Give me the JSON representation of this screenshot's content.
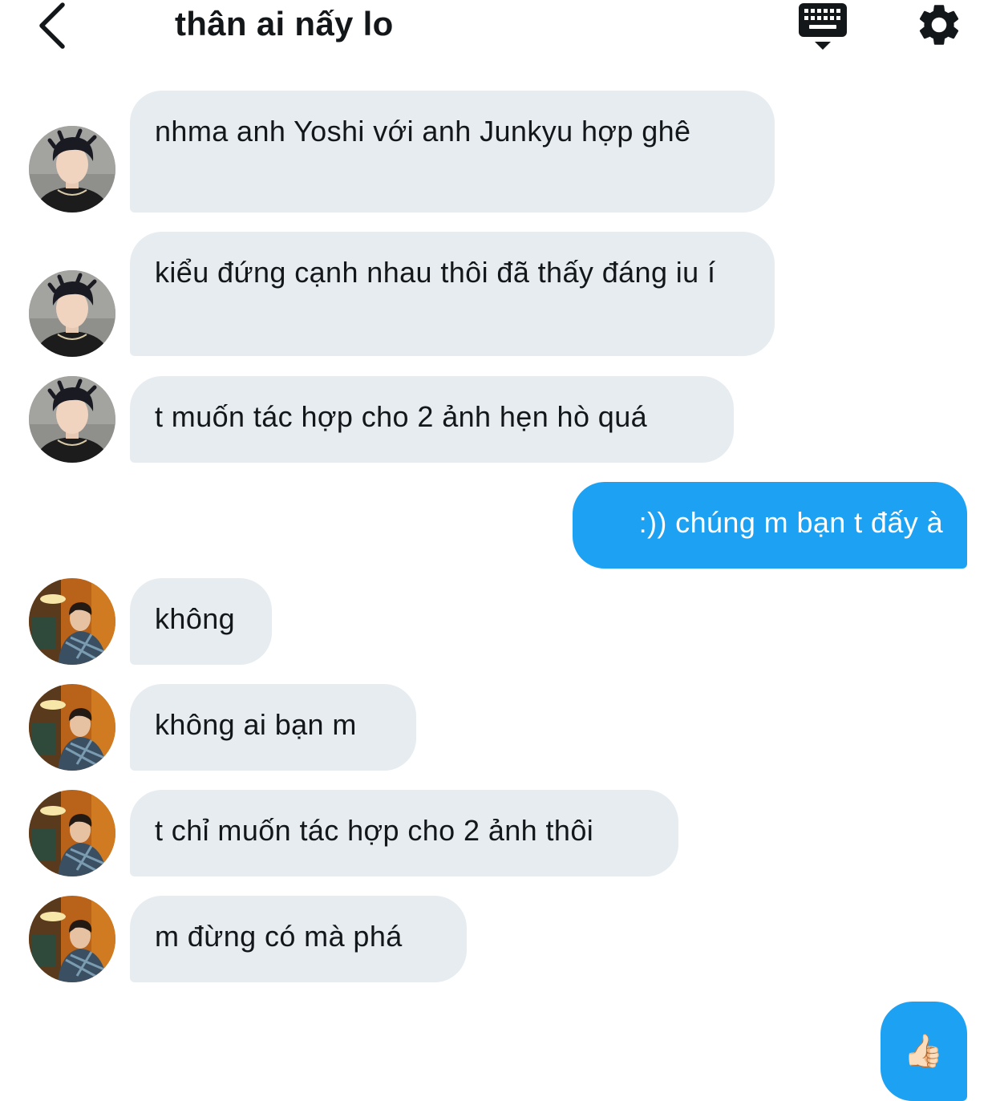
{
  "header": {
    "title": "thân ai nấy lo",
    "back_icon": "chevron-left-icon",
    "keyboard_icon": "keyboard-icon",
    "settings_icon": "gear-icon"
  },
  "colors": {
    "incoming_bubble": "#e6ecf0",
    "outgoing_bubble": "#1da1f2",
    "text": "#14171a"
  },
  "messages": [
    {
      "direction": "incoming",
      "sender": "person-a",
      "text": "nhma anh Yoshi với anh Junkyu hợp ghê"
    },
    {
      "direction": "incoming",
      "sender": "person-a",
      "text": "kiểu đứng cạnh nhau thôi đã thấy đáng iu í"
    },
    {
      "direction": "incoming",
      "sender": "person-a",
      "text": "t muốn tác hợp cho 2 ảnh hẹn hò quá"
    },
    {
      "direction": "outgoing",
      "text": ":)) chúng m bạn t đấy à"
    },
    {
      "direction": "incoming",
      "sender": "person-b",
      "text": "không"
    },
    {
      "direction": "incoming",
      "sender": "person-b",
      "text": "không ai bạn m"
    },
    {
      "direction": "incoming",
      "sender": "person-b",
      "text": "t chỉ muốn tác hợp cho 2 ảnh thôi"
    },
    {
      "direction": "incoming",
      "sender": "person-b",
      "text": "m đừng có mà phá"
    },
    {
      "direction": "outgoing",
      "text": "👍🏻"
    }
  ]
}
